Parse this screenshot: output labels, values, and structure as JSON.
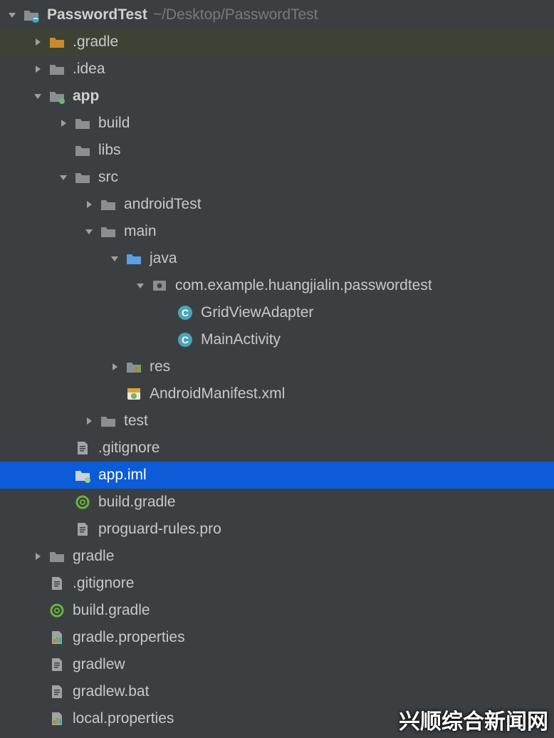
{
  "root": {
    "name": "PasswordTest",
    "path": "~/Desktop/PasswordTest"
  },
  "items": {
    "gradleDir": ".gradle",
    "idea": ".idea",
    "app": "app",
    "build": "build",
    "libs": "libs",
    "src": "src",
    "androidTest": "androidTest",
    "main": "main",
    "java": "java",
    "pkg": "com.example.huangjialin.passwordtest",
    "gridViewAdapter": "GridViewAdapter",
    "mainActivity": "MainActivity",
    "res": "res",
    "manifest": "AndroidManifest.xml",
    "test": "test",
    "appGitignore": ".gitignore",
    "appIml": "app.iml",
    "appBuildGradle": "build.gradle",
    "proguard": "proguard-rules.pro",
    "gradleFolder": "gradle",
    "rootGitignore": ".gitignore",
    "rootBuildGradle": "build.gradle",
    "gradleProps": "gradle.properties",
    "gradlew": "gradlew",
    "gradlewBat": "gradlew.bat",
    "localProps": "local.properties"
  },
  "watermark": "兴顺综合新闻网"
}
